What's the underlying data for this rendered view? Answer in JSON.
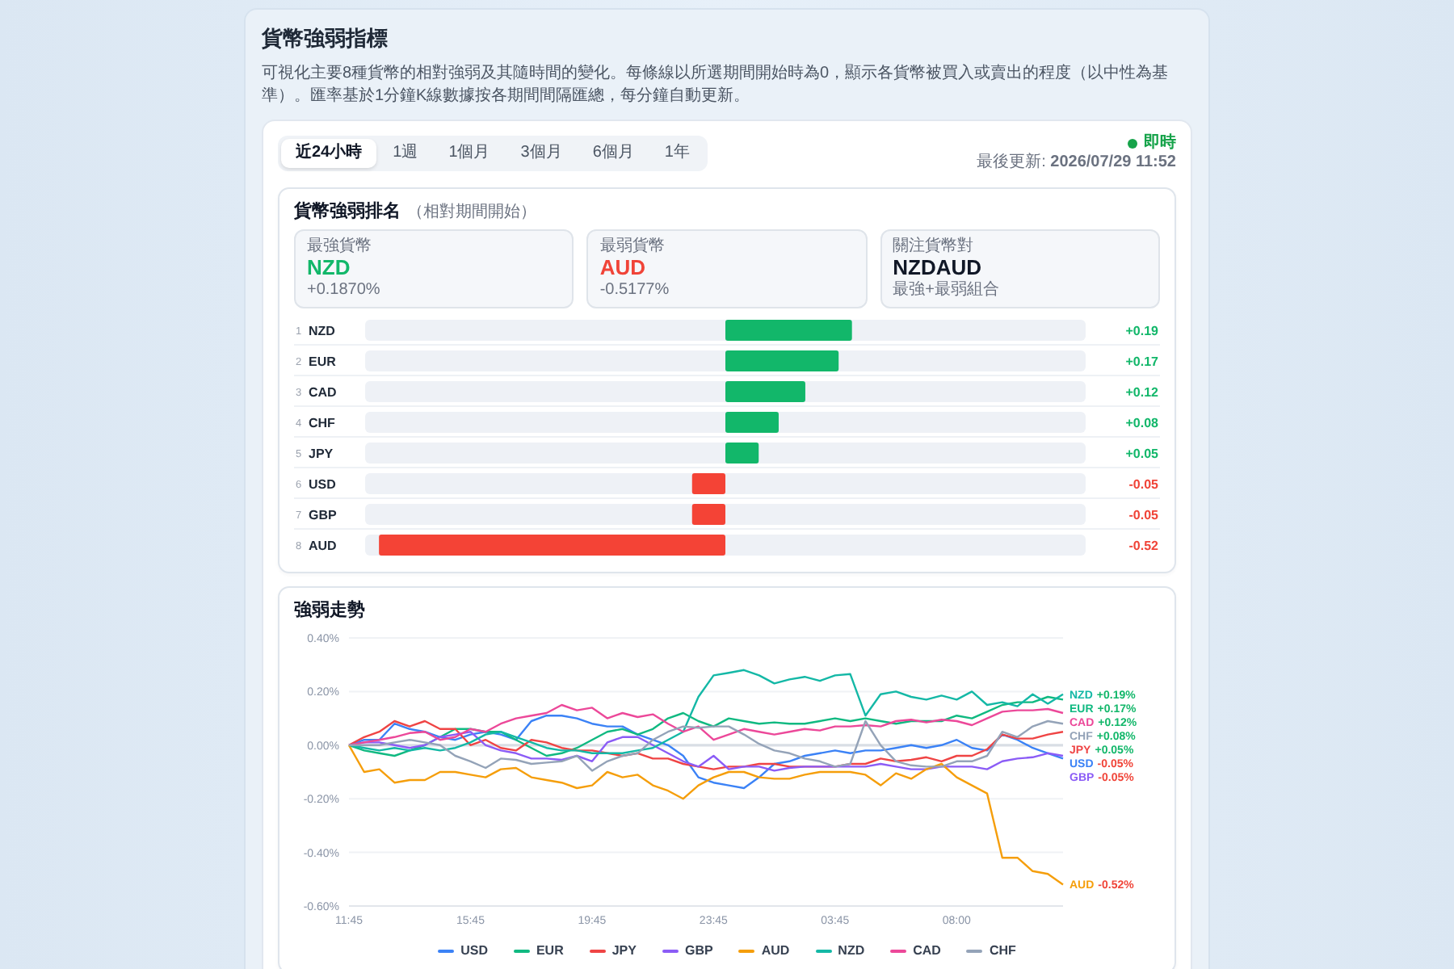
{
  "title": "貨幣強弱指標",
  "description": "可視化主要8種貨幣的相對強弱及其隨時間的變化。每條線以所選期間開始時為0，顯示各貨幣被買入或賣出的程度（以中性為基準）。匯率基於1分鐘K線數據按各期間間隔匯總，每分鐘自動更新。",
  "period_tabs": [
    {
      "label": "近24小時",
      "selected": true
    },
    {
      "label": "1週",
      "selected": false
    },
    {
      "label": "1個月",
      "selected": false
    },
    {
      "label": "3個月",
      "selected": false
    },
    {
      "label": "6個月",
      "selected": false
    },
    {
      "label": "1年",
      "selected": false
    }
  ],
  "live_status": {
    "label": "即時",
    "on": true
  },
  "last_updated": "最後更新: **2026/07/29 11:52**",
  "ranking": {
    "title": "貨幣強弱排名",
    "subtitle": "（相對期間開始）",
    "summary_cards": [
      {
        "kind": "strongest",
        "label": "最強貨幣",
        "value": "NZD",
        "detail": "+0.1870%"
      },
      {
        "kind": "weakest",
        "label": "最弱貨幣",
        "value": "AUD",
        "detail": "-0.5177%"
      },
      {
        "kind": "pair",
        "label": "關注貨幣對",
        "value": "NZDAUD",
        "detail": "最強+最弱組合"
      }
    ],
    "rank_labels": [
      "1",
      "2",
      "3",
      "4",
      "5",
      "6",
      "7",
      "8"
    ],
    "chart_data": {
      "type": "bar",
      "orientation": "horizontal",
      "categories": [
        "NZD",
        "EUR",
        "CAD",
        "CHF",
        "JPY",
        "USD",
        "GBP",
        "AUD"
      ],
      "values": [
        0.19,
        0.17,
        0.12,
        0.08,
        0.05,
        -0.05,
        -0.05,
        -0.52
      ],
      "value_labels": [
        "+0.19",
        "+0.17",
        "+0.12",
        "+0.08",
        "+0.05",
        "-0.05",
        "-0.05",
        "-0.52"
      ]
    }
  },
  "trend_chart": {
    "title": "強弱走勢",
    "chart_data": {
      "type": "line",
      "grid": true,
      "categories": [
        "11:45",
        null,
        null,
        null,
        null,
        null,
        null,
        null,
        "15:45",
        null,
        null,
        null,
        null,
        null,
        null,
        null,
        "19:45",
        null,
        null,
        null,
        null,
        null,
        null,
        null,
        "23:45",
        null,
        null,
        null,
        null,
        null,
        null,
        null,
        "03:45",
        null,
        null,
        null,
        null,
        null,
        null,
        null,
        "08:00",
        null,
        null,
        null,
        null,
        null,
        null,
        null
      ],
      "ylim": [
        -0.6,
        0.4
      ],
      "yticks": [
        {
          "value": 0.4,
          "label": "0.40%"
        },
        {
          "value": 0.2,
          "label": "0.20%"
        },
        {
          "value": 0,
          "label": "0.00%"
        },
        {
          "value": -0.2,
          "label": "-0.20%"
        },
        {
          "value": -0.4,
          "label": "-0.40%"
        },
        {
          "value": -0.6,
          "label": "-0.60%"
        }
      ],
      "series": [
        {
          "name": "USD",
          "color": "#3b82f6",
          "values": [
            0,
            0.02,
            0.02,
            0.08,
            0.06,
            0.05,
            0.03,
            0.02,
            0.04,
            0.05,
            0.04,
            0.02,
            0.09,
            0.11,
            0.11,
            0.1,
            0.08,
            0.07,
            0.07,
            0.04,
            0.02,
            0,
            -0.04,
            -0.12,
            -0.14,
            -0.15,
            -0.16,
            -0.12,
            -0.07,
            -0.06,
            -0.04,
            -0.03,
            -0.02,
            -0.03,
            -0.02,
            -0.02,
            -0.01,
            0,
            -0.01,
            0,
            0.02,
            -0.01,
            -0.02,
            0.04,
            0.02,
            -0.01,
            -0.03,
            -0.05
          ]
        },
        {
          "name": "EUR",
          "color": "#10b981",
          "values": [
            0,
            -0.02,
            -0.03,
            -0.04,
            -0.02,
            0,
            0.03,
            0.06,
            0.06,
            0.05,
            0.05,
            0.02,
            -0.01,
            -0.04,
            -0.03,
            -0.01,
            0.02,
            0.05,
            0.06,
            0.04,
            0.06,
            0.1,
            0.12,
            0.09,
            0.07,
            0.1,
            0.09,
            0.08,
            0.085,
            0.08,
            0.08,
            0.09,
            0.1,
            0.09,
            0.1,
            0.09,
            0.08,
            0.09,
            0.09,
            0.09,
            0.11,
            0.1,
            0.125,
            0.15,
            0.16,
            0.16,
            0.18,
            0.17
          ]
        },
        {
          "name": "JPY",
          "color": "#ef4444",
          "values": [
            0,
            0.03,
            0.05,
            0.09,
            0.07,
            0.09,
            0.06,
            0.06,
            0,
            0.02,
            -0.01,
            -0.02,
            0.02,
            0.01,
            -0.01,
            -0.02,
            -0.02,
            -0.03,
            -0.04,
            -0.03,
            -0.05,
            -0.05,
            -0.07,
            -0.08,
            -0.09,
            -0.08,
            -0.08,
            -0.07,
            -0.07,
            -0.08,
            -0.08,
            -0.08,
            -0.08,
            -0.07,
            -0.07,
            -0.05,
            -0.06,
            -0.055,
            -0.045,
            -0.06,
            -0.04,
            -0.04,
            -0.015,
            0.04,
            0.025,
            0.025,
            0.04,
            0.05
          ]
        },
        {
          "name": "GBP",
          "color": "#8b5cf6",
          "values": [
            0,
            0.01,
            0.01,
            0,
            -0.01,
            0,
            0.03,
            0.04,
            0.05,
            0,
            -0.02,
            -0.03,
            -0.05,
            -0.05,
            -0.055,
            -0.04,
            -0.06,
            0.01,
            0.03,
            0.03,
            0,
            -0.03,
            -0.06,
            -0.08,
            -0.04,
            -0.09,
            -0.08,
            -0.08,
            -0.095,
            -0.085,
            -0.08,
            -0.08,
            -0.08,
            -0.08,
            -0.08,
            -0.07,
            -0.08,
            -0.09,
            -0.09,
            -0.08,
            -0.08,
            -0.08,
            -0.09,
            -0.06,
            -0.05,
            -0.045,
            -0.03,
            -0.04
          ]
        },
        {
          "name": "AUD",
          "color": "#f59e0b",
          "values": [
            0,
            -0.1,
            -0.09,
            -0.14,
            -0.13,
            -0.13,
            -0.1,
            -0.1,
            -0.11,
            -0.12,
            -0.09,
            -0.085,
            -0.12,
            -0.13,
            -0.14,
            -0.16,
            -0.15,
            -0.1,
            -0.12,
            -0.11,
            -0.15,
            -0.17,
            -0.2,
            -0.15,
            -0.12,
            -0.1,
            -0.1,
            -0.12,
            -0.125,
            -0.125,
            -0.11,
            -0.1,
            -0.1,
            -0.1,
            -0.11,
            -0.15,
            -0.105,
            -0.125,
            -0.09,
            -0.07,
            -0.12,
            -0.15,
            -0.18,
            -0.42,
            -0.42,
            -0.47,
            -0.48,
            -0.52
          ]
        },
        {
          "name": "NZD",
          "color": "#14b8a6",
          "values": [
            0,
            -0.01,
            -0.02,
            -0.01,
            -0.02,
            -0.01,
            -0.02,
            -0.01,
            0.01,
            0.04,
            0.05,
            0.03,
            0.01,
            -0.01,
            -0.02,
            -0.02,
            -0.03,
            -0.03,
            -0.03,
            -0.02,
            -0.01,
            0.02,
            0.05,
            0.18,
            0.26,
            0.27,
            0.28,
            0.26,
            0.23,
            0.245,
            0.255,
            0.24,
            0.26,
            0.265,
            0.11,
            0.19,
            0.2,
            0.18,
            0.17,
            0.185,
            0.17,
            0.2,
            0.15,
            0.16,
            0.145,
            0.19,
            0.155,
            0.19
          ]
        },
        {
          "name": "CAD",
          "color": "#ec4899",
          "values": [
            0,
            0.01,
            0.02,
            0.03,
            0.045,
            0.05,
            0.02,
            0.03,
            0.06,
            0.05,
            0.08,
            0.1,
            0.11,
            0.12,
            0.15,
            0.13,
            0.14,
            0.1,
            0.12,
            0.105,
            0.115,
            0.08,
            0.05,
            0.07,
            0.02,
            0.04,
            0.06,
            0.05,
            0.04,
            0.05,
            0.06,
            0.055,
            0.07,
            0.07,
            0.075,
            0.07,
            0.09,
            0.095,
            0.085,
            0.095,
            0.09,
            0.075,
            0.1,
            0.125,
            0.13,
            0.13,
            0.135,
            0.12
          ]
        },
        {
          "name": "CHF",
          "color": "#94a3b8",
          "values": [
            0,
            0,
            0,
            0.01,
            0.02,
            0.01,
            0,
            -0.04,
            -0.06,
            -0.085,
            -0.05,
            -0.055,
            -0.07,
            -0.065,
            -0.06,
            -0.04,
            -0.095,
            -0.06,
            -0.04,
            -0.03,
            0.02,
            0.05,
            0.07,
            0.065,
            0.07,
            0.07,
            0.04,
            0.005,
            -0.02,
            -0.03,
            -0.05,
            -0.06,
            -0.08,
            -0.07,
            0.09,
            0,
            -0.06,
            -0.075,
            -0.08,
            -0.08,
            -0.06,
            -0.06,
            -0.04,
            0.05,
            0.03,
            0.07,
            0.09,
            0.08
          ]
        }
      ]
    },
    "end_labels": [
      {
        "currency": "NZD",
        "value": "+0.19%",
        "positive": true,
        "color": "#14b8a6"
      },
      {
        "currency": "EUR",
        "value": "+0.17%",
        "positive": true,
        "color": "#10b981"
      },
      {
        "currency": "CAD",
        "value": "+0.12%",
        "positive": true,
        "color": "#ec4899"
      },
      {
        "currency": "CHF",
        "value": "+0.08%",
        "positive": true,
        "color": "#94a3b8"
      },
      {
        "currency": "JPY",
        "value": "+0.05%",
        "positive": true,
        "color": "#ef4444"
      },
      {
        "currency": "USD",
        "value": "-0.05%",
        "positive": false,
        "color": "#3b82f6"
      },
      {
        "currency": "GBP",
        "value": "-0.05%",
        "positive": false,
        "color": "#8b5cf6"
      },
      {
        "currency": "AUD",
        "value": "-0.52%",
        "positive": false,
        "color": "#f59e0b"
      }
    ]
  }
}
